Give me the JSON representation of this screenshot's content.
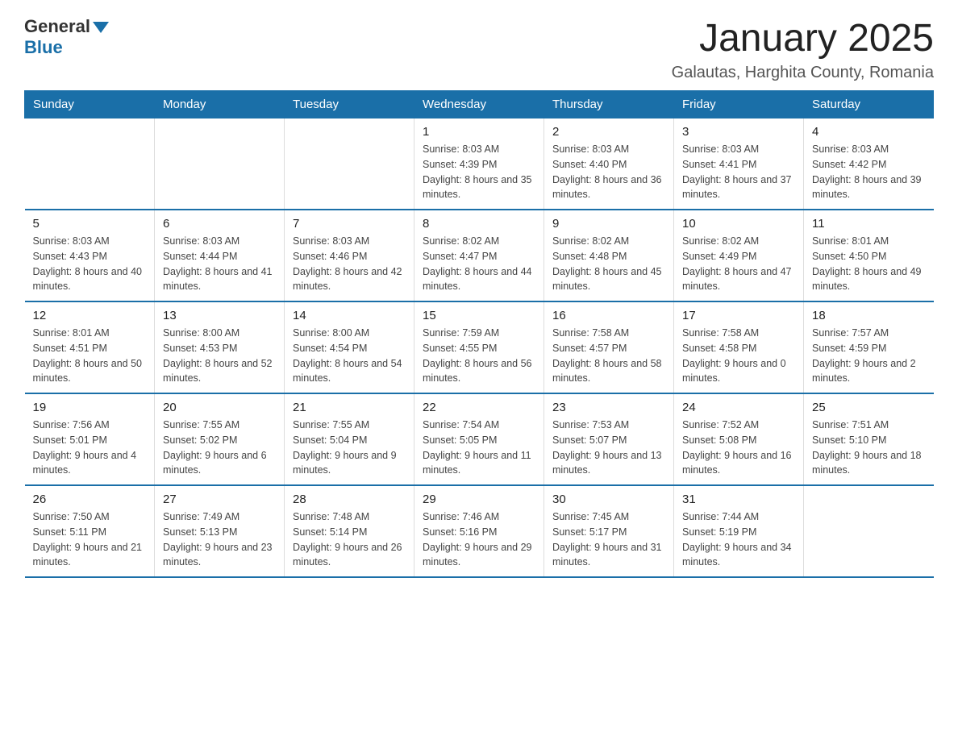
{
  "header": {
    "logo_general": "General",
    "logo_blue": "Blue",
    "title": "January 2025",
    "subtitle": "Galautas, Harghita County, Romania"
  },
  "weekdays": [
    "Sunday",
    "Monday",
    "Tuesday",
    "Wednesday",
    "Thursday",
    "Friday",
    "Saturday"
  ],
  "weeks": [
    [
      {
        "day": "",
        "info": ""
      },
      {
        "day": "",
        "info": ""
      },
      {
        "day": "",
        "info": ""
      },
      {
        "day": "1",
        "info": "Sunrise: 8:03 AM\nSunset: 4:39 PM\nDaylight: 8 hours and 35 minutes."
      },
      {
        "day": "2",
        "info": "Sunrise: 8:03 AM\nSunset: 4:40 PM\nDaylight: 8 hours and 36 minutes."
      },
      {
        "day": "3",
        "info": "Sunrise: 8:03 AM\nSunset: 4:41 PM\nDaylight: 8 hours and 37 minutes."
      },
      {
        "day": "4",
        "info": "Sunrise: 8:03 AM\nSunset: 4:42 PM\nDaylight: 8 hours and 39 minutes."
      }
    ],
    [
      {
        "day": "5",
        "info": "Sunrise: 8:03 AM\nSunset: 4:43 PM\nDaylight: 8 hours and 40 minutes."
      },
      {
        "day": "6",
        "info": "Sunrise: 8:03 AM\nSunset: 4:44 PM\nDaylight: 8 hours and 41 minutes."
      },
      {
        "day": "7",
        "info": "Sunrise: 8:03 AM\nSunset: 4:46 PM\nDaylight: 8 hours and 42 minutes."
      },
      {
        "day": "8",
        "info": "Sunrise: 8:02 AM\nSunset: 4:47 PM\nDaylight: 8 hours and 44 minutes."
      },
      {
        "day": "9",
        "info": "Sunrise: 8:02 AM\nSunset: 4:48 PM\nDaylight: 8 hours and 45 minutes."
      },
      {
        "day": "10",
        "info": "Sunrise: 8:02 AM\nSunset: 4:49 PM\nDaylight: 8 hours and 47 minutes."
      },
      {
        "day": "11",
        "info": "Sunrise: 8:01 AM\nSunset: 4:50 PM\nDaylight: 8 hours and 49 minutes."
      }
    ],
    [
      {
        "day": "12",
        "info": "Sunrise: 8:01 AM\nSunset: 4:51 PM\nDaylight: 8 hours and 50 minutes."
      },
      {
        "day": "13",
        "info": "Sunrise: 8:00 AM\nSunset: 4:53 PM\nDaylight: 8 hours and 52 minutes."
      },
      {
        "day": "14",
        "info": "Sunrise: 8:00 AM\nSunset: 4:54 PM\nDaylight: 8 hours and 54 minutes."
      },
      {
        "day": "15",
        "info": "Sunrise: 7:59 AM\nSunset: 4:55 PM\nDaylight: 8 hours and 56 minutes."
      },
      {
        "day": "16",
        "info": "Sunrise: 7:58 AM\nSunset: 4:57 PM\nDaylight: 8 hours and 58 minutes."
      },
      {
        "day": "17",
        "info": "Sunrise: 7:58 AM\nSunset: 4:58 PM\nDaylight: 9 hours and 0 minutes."
      },
      {
        "day": "18",
        "info": "Sunrise: 7:57 AM\nSunset: 4:59 PM\nDaylight: 9 hours and 2 minutes."
      }
    ],
    [
      {
        "day": "19",
        "info": "Sunrise: 7:56 AM\nSunset: 5:01 PM\nDaylight: 9 hours and 4 minutes."
      },
      {
        "day": "20",
        "info": "Sunrise: 7:55 AM\nSunset: 5:02 PM\nDaylight: 9 hours and 6 minutes."
      },
      {
        "day": "21",
        "info": "Sunrise: 7:55 AM\nSunset: 5:04 PM\nDaylight: 9 hours and 9 minutes."
      },
      {
        "day": "22",
        "info": "Sunrise: 7:54 AM\nSunset: 5:05 PM\nDaylight: 9 hours and 11 minutes."
      },
      {
        "day": "23",
        "info": "Sunrise: 7:53 AM\nSunset: 5:07 PM\nDaylight: 9 hours and 13 minutes."
      },
      {
        "day": "24",
        "info": "Sunrise: 7:52 AM\nSunset: 5:08 PM\nDaylight: 9 hours and 16 minutes."
      },
      {
        "day": "25",
        "info": "Sunrise: 7:51 AM\nSunset: 5:10 PM\nDaylight: 9 hours and 18 minutes."
      }
    ],
    [
      {
        "day": "26",
        "info": "Sunrise: 7:50 AM\nSunset: 5:11 PM\nDaylight: 9 hours and 21 minutes."
      },
      {
        "day": "27",
        "info": "Sunrise: 7:49 AM\nSunset: 5:13 PM\nDaylight: 9 hours and 23 minutes."
      },
      {
        "day": "28",
        "info": "Sunrise: 7:48 AM\nSunset: 5:14 PM\nDaylight: 9 hours and 26 minutes."
      },
      {
        "day": "29",
        "info": "Sunrise: 7:46 AM\nSunset: 5:16 PM\nDaylight: 9 hours and 29 minutes."
      },
      {
        "day": "30",
        "info": "Sunrise: 7:45 AM\nSunset: 5:17 PM\nDaylight: 9 hours and 31 minutes."
      },
      {
        "day": "31",
        "info": "Sunrise: 7:44 AM\nSunset: 5:19 PM\nDaylight: 9 hours and 34 minutes."
      },
      {
        "day": "",
        "info": ""
      }
    ]
  ]
}
